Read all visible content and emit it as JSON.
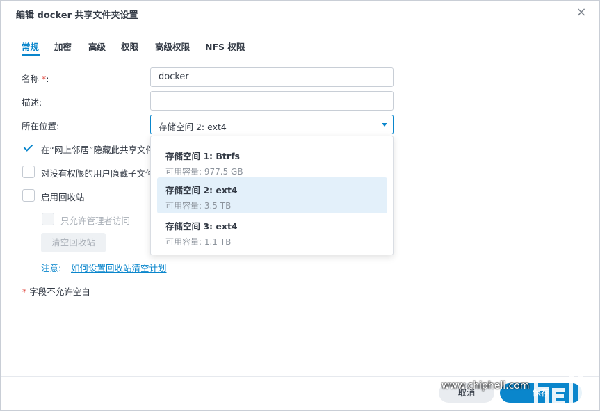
{
  "dialog": {
    "title": "编辑 docker 共享文件夹设置",
    "close_glyph": "×"
  },
  "tabs": [
    {
      "label": "常规",
      "active": true
    },
    {
      "label": "加密"
    },
    {
      "label": "高级"
    },
    {
      "label": "权限"
    },
    {
      "label": "高级权限"
    },
    {
      "label": "NFS 权限"
    }
  ],
  "form": {
    "name_label": "名称",
    "name_required_mark": "*",
    "name_colon": ":",
    "name_value": "docker",
    "desc_label": "描述:",
    "desc_value": "",
    "location_label": "所在位置:",
    "location_value": "存储空间 2:  ext4"
  },
  "checkboxes": {
    "hide_network": {
      "label": "在“网上邻居”隐藏此共享文件",
      "checked": true
    },
    "hide_subfolders": {
      "label": "对没有权限的用户隐藏子文件",
      "checked": false
    },
    "recycle_bin": {
      "label": "启用回收站",
      "checked": false
    },
    "admin_only": {
      "label": "只允许管理者访问",
      "checked": false,
      "disabled": true
    }
  },
  "buttons": {
    "empty_recycle": "清空回收站",
    "cancel": "取消",
    "save": "保存"
  },
  "note": {
    "prefix": "注意:",
    "link": "如何设置回收站清空计划"
  },
  "footnote": {
    "mark": "*",
    "text": " 字段不允许空白"
  },
  "dropdown": {
    "options": [
      {
        "name": "存储空间 1:  Btrfs",
        "capacity": "可用容量:  977.5 GB",
        "selected": false
      },
      {
        "name": "存储空间 2:  ext4",
        "capacity": "可用容量:  3.5 TB",
        "selected": true
      },
      {
        "name": "存储空间 3:  ext4",
        "capacity": "可用容量:  1.1 TB",
        "selected": false
      }
    ]
  },
  "watermark": {
    "text": "www.chiphell.com"
  },
  "colors": {
    "accent": "#0a86cc",
    "required": "#e0463e"
  }
}
